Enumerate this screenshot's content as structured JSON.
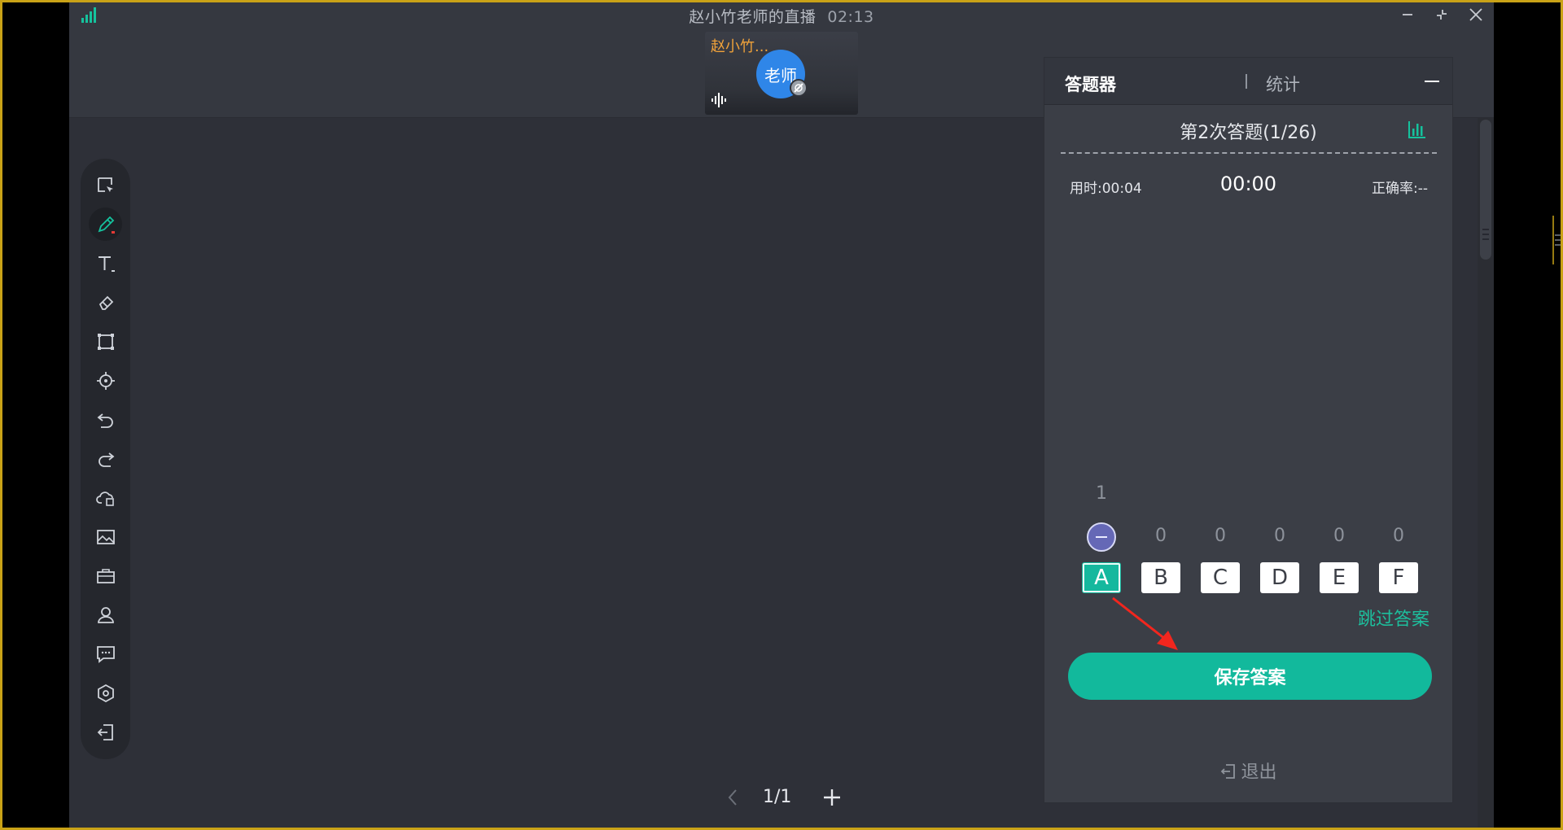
{
  "window": {
    "title": "赵小竹老师的直播",
    "elapsed_time": "02:13",
    "controls": [
      "minimize-icon",
      "restore-icon",
      "close-icon"
    ]
  },
  "video": {
    "name": "赵小竹...",
    "avatar_label": "老师"
  },
  "toolbar": {
    "items": [
      {
        "name": "select-tool",
        "icon": "cursor-select-icon"
      },
      {
        "name": "pen-tool",
        "icon": "pen-icon",
        "active": true
      },
      {
        "name": "text-tool",
        "icon": "text-icon"
      },
      {
        "name": "eraser-tool",
        "icon": "eraser-icon"
      },
      {
        "name": "shape-tool",
        "icon": "rectangle-icon"
      },
      {
        "name": "laser-pointer-tool",
        "icon": "crosshair-icon"
      },
      {
        "name": "undo-tool",
        "icon": "undo-icon"
      },
      {
        "name": "redo-tool",
        "icon": "redo-icon"
      },
      {
        "name": "cloud-files-tool",
        "icon": "cloud-file-icon"
      },
      {
        "name": "image-tool",
        "icon": "image-icon"
      },
      {
        "name": "toolbox-tool",
        "icon": "toolbox-icon"
      },
      {
        "name": "roster-tool",
        "icon": "user-icon"
      },
      {
        "name": "chat-tool",
        "icon": "chat-icon"
      },
      {
        "name": "settings-tool",
        "icon": "settings-icon"
      },
      {
        "name": "exit-tool",
        "icon": "exit-icon"
      }
    ],
    "colors": {
      "active": "#15c29d",
      "dot": "#e53935"
    }
  },
  "pager": {
    "current": "1/1"
  },
  "answer_panel": {
    "tab_main": "答题器",
    "tab_stats": "统计",
    "question_title": "第2次答题(1/26)",
    "time_used": "用时:00:04",
    "timer": "00:00",
    "accuracy": "正确率:--",
    "options": [
      {
        "label": "A",
        "count": "1",
        "selected": true
      },
      {
        "label": "B",
        "count": "0",
        "selected": false
      },
      {
        "label": "C",
        "count": "0",
        "selected": false
      },
      {
        "label": "D",
        "count": "0",
        "selected": false
      },
      {
        "label": "E",
        "count": "0",
        "selected": false
      },
      {
        "label": "F",
        "count": "0",
        "selected": false
      }
    ],
    "skip_label": "跳过答案",
    "save_label": "保存答案",
    "exit_label": "退出",
    "accent_color": "#12b99c"
  }
}
